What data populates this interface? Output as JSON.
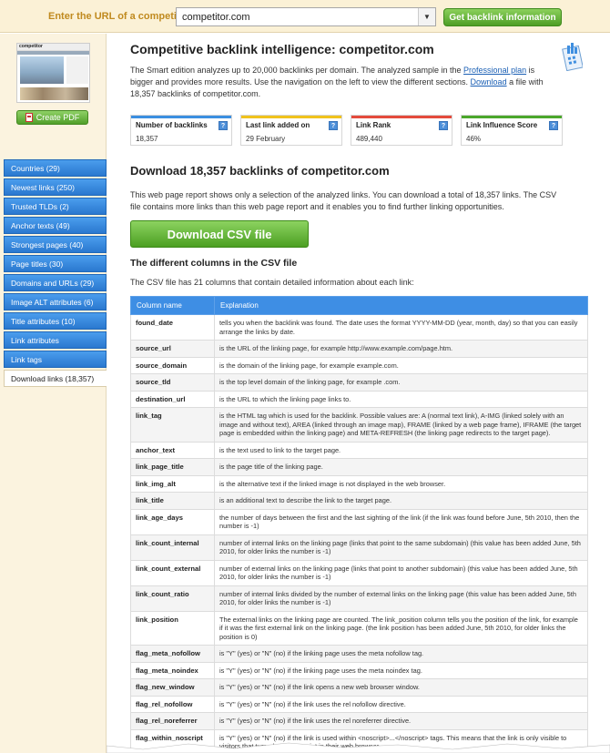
{
  "topbar": {
    "label": "Enter the URL of a competitor:",
    "url_value": "competitor.com",
    "submit_label": "Get backlink information"
  },
  "sidebar": {
    "thumb_title": "competitor",
    "create_pdf_label": "Create PDF",
    "items": [
      {
        "label": "Countries (29)"
      },
      {
        "label": "Newest links (250)"
      },
      {
        "label": "Trusted TLDs (2)"
      },
      {
        "label": "Anchor texts (49)"
      },
      {
        "label": "Strongest pages (40)"
      },
      {
        "label": "Page titles (30)"
      },
      {
        "label": "Domains and URLs (29)"
      },
      {
        "label": "Image ALT attributes (6)"
      },
      {
        "label": "Title attributes (10)"
      },
      {
        "label": "Link attributes"
      },
      {
        "label": "Link tags"
      },
      {
        "label": "Download links (18,357)"
      }
    ]
  },
  "main": {
    "title": "Competitive backlink intelligence: competitor.com",
    "intro_part1": "The Smart edition analyzes up to 20,000 backlinks per domain. The analyzed sample in the ",
    "intro_link_plan": "Professional plan",
    "intro_part2": " is bigger and provides more results. Use the navigation on the left to view the different sections. ",
    "intro_link_download": "Download",
    "intro_part3": " a file with 18,357 backlinks of competitor.com.",
    "stats": [
      {
        "label": "Number of backlinks",
        "value": "18,357",
        "color": "#3b8fe0"
      },
      {
        "label": "Last link added on",
        "value": "29 February",
        "color": "#f0c21c"
      },
      {
        "label": "Link Rank",
        "value": "489,440",
        "color": "#e44a3c"
      },
      {
        "label": "Link Influence Score",
        "value": "46%",
        "color": "#4aa72b"
      }
    ],
    "download_title": "Download 18,357 backlinks of competitor.com",
    "download_text": "This web page report shows only a selection of the analyzed links. You can download a total of 18,357 links. The CSV file contains more links than this web page report and it enables you to find further linking opportunities.",
    "csv_button": "Download CSV file",
    "columns_title": "The different columns in the CSV file",
    "columns_text": "The CSV file has 21 columns that contain detailed information about each link:",
    "table_headers": [
      "Column name",
      "Explanation"
    ],
    "rows": [
      {
        "name": "found_date",
        "explanation": "tells you when the backlink was found. The date uses the format YYYY-MM-DD (year, month, day) so that you can easily arrange the links by date."
      },
      {
        "name": "source_url",
        "explanation": "is the URL of the linking page, for example http://www.example.com/page.htm."
      },
      {
        "name": "source_domain",
        "explanation": "is the domain of the linking page, for example example.com."
      },
      {
        "name": "source_tld",
        "explanation": "is the top level domain of the linking page, for example .com."
      },
      {
        "name": "destination_url",
        "explanation": "is the URL to which the linking page links to."
      },
      {
        "name": "link_tag",
        "explanation": "is the HTML tag which is used for the backlink. Possible values are: A (normal text link), A-IMG (linked solely with an image and without text), AREA (linked through an image map), FRAME (linked by a web page frame), IFRAME (the target page is embedded within the linking page) and META-REFRESH (the linking page redirects to the target page)."
      },
      {
        "name": "anchor_text",
        "explanation": "is the text used to link to the target page."
      },
      {
        "name": "link_page_title",
        "explanation": "is the page title of the linking page."
      },
      {
        "name": "link_img_alt",
        "explanation": "is the alternative text if the linked image is not displayed in the web browser."
      },
      {
        "name": "link_title",
        "explanation": "is an additional text to describe the link to the target page."
      },
      {
        "name": "link_age_days",
        "explanation": "the number of days between the first and the last sighting of the link (if the link was found before June, 5th 2010, then the number is -1)"
      },
      {
        "name": "link_count_internal",
        "explanation": "number of internal links on the linking page (links that point to the same subdomain) (this value has been added June, 5th 2010, for older links the number is -1)"
      },
      {
        "name": "link_count_external",
        "explanation": "number of external links on the linking page (links that point to another subdomain) (this value has been added June, 5th 2010, for older links the number is -1)"
      },
      {
        "name": "link_count_ratio",
        "explanation": "number of internal links divided by the number of external links on the linking page (this value has been added June, 5th 2010, for older links the number is -1)"
      },
      {
        "name": "link_position",
        "explanation": "The external links on the linking page are counted. The link_position column tells you the position of the link, for example if it was the first external link on the linking page. (the link position has been added June, 5th 2010, for older links the position is 0)"
      },
      {
        "name": "flag_meta_nofollow",
        "explanation": "is \"Y\" (yes) or \"N\" (no) if the linking page uses the meta nofollow tag."
      },
      {
        "name": "flag_meta_noindex",
        "explanation": "is \"Y\" (yes) or \"N\" (no) if the linking page uses the meta noindex tag."
      },
      {
        "name": "flag_new_window",
        "explanation": "is \"Y\" (yes) or \"N\" (no) if the link opens a new web browser window."
      },
      {
        "name": "flag_rel_nofollow",
        "explanation": "is \"Y\" (yes) or \"N\" (no) if the link uses the rel nofollow directive."
      },
      {
        "name": "flag_rel_noreferrer",
        "explanation": "is \"Y\" (yes) or \"N\" (no) if the link uses the rel noreferrer directive."
      },
      {
        "name": "flag_within_noscript",
        "explanation": "is \"Y\" (yes) or \"N\" (no) if the link is used within <noscript>...</noscript> tags. This means that the link is only visible to visitors that turned off JavaScript in their web browser."
      }
    ]
  }
}
